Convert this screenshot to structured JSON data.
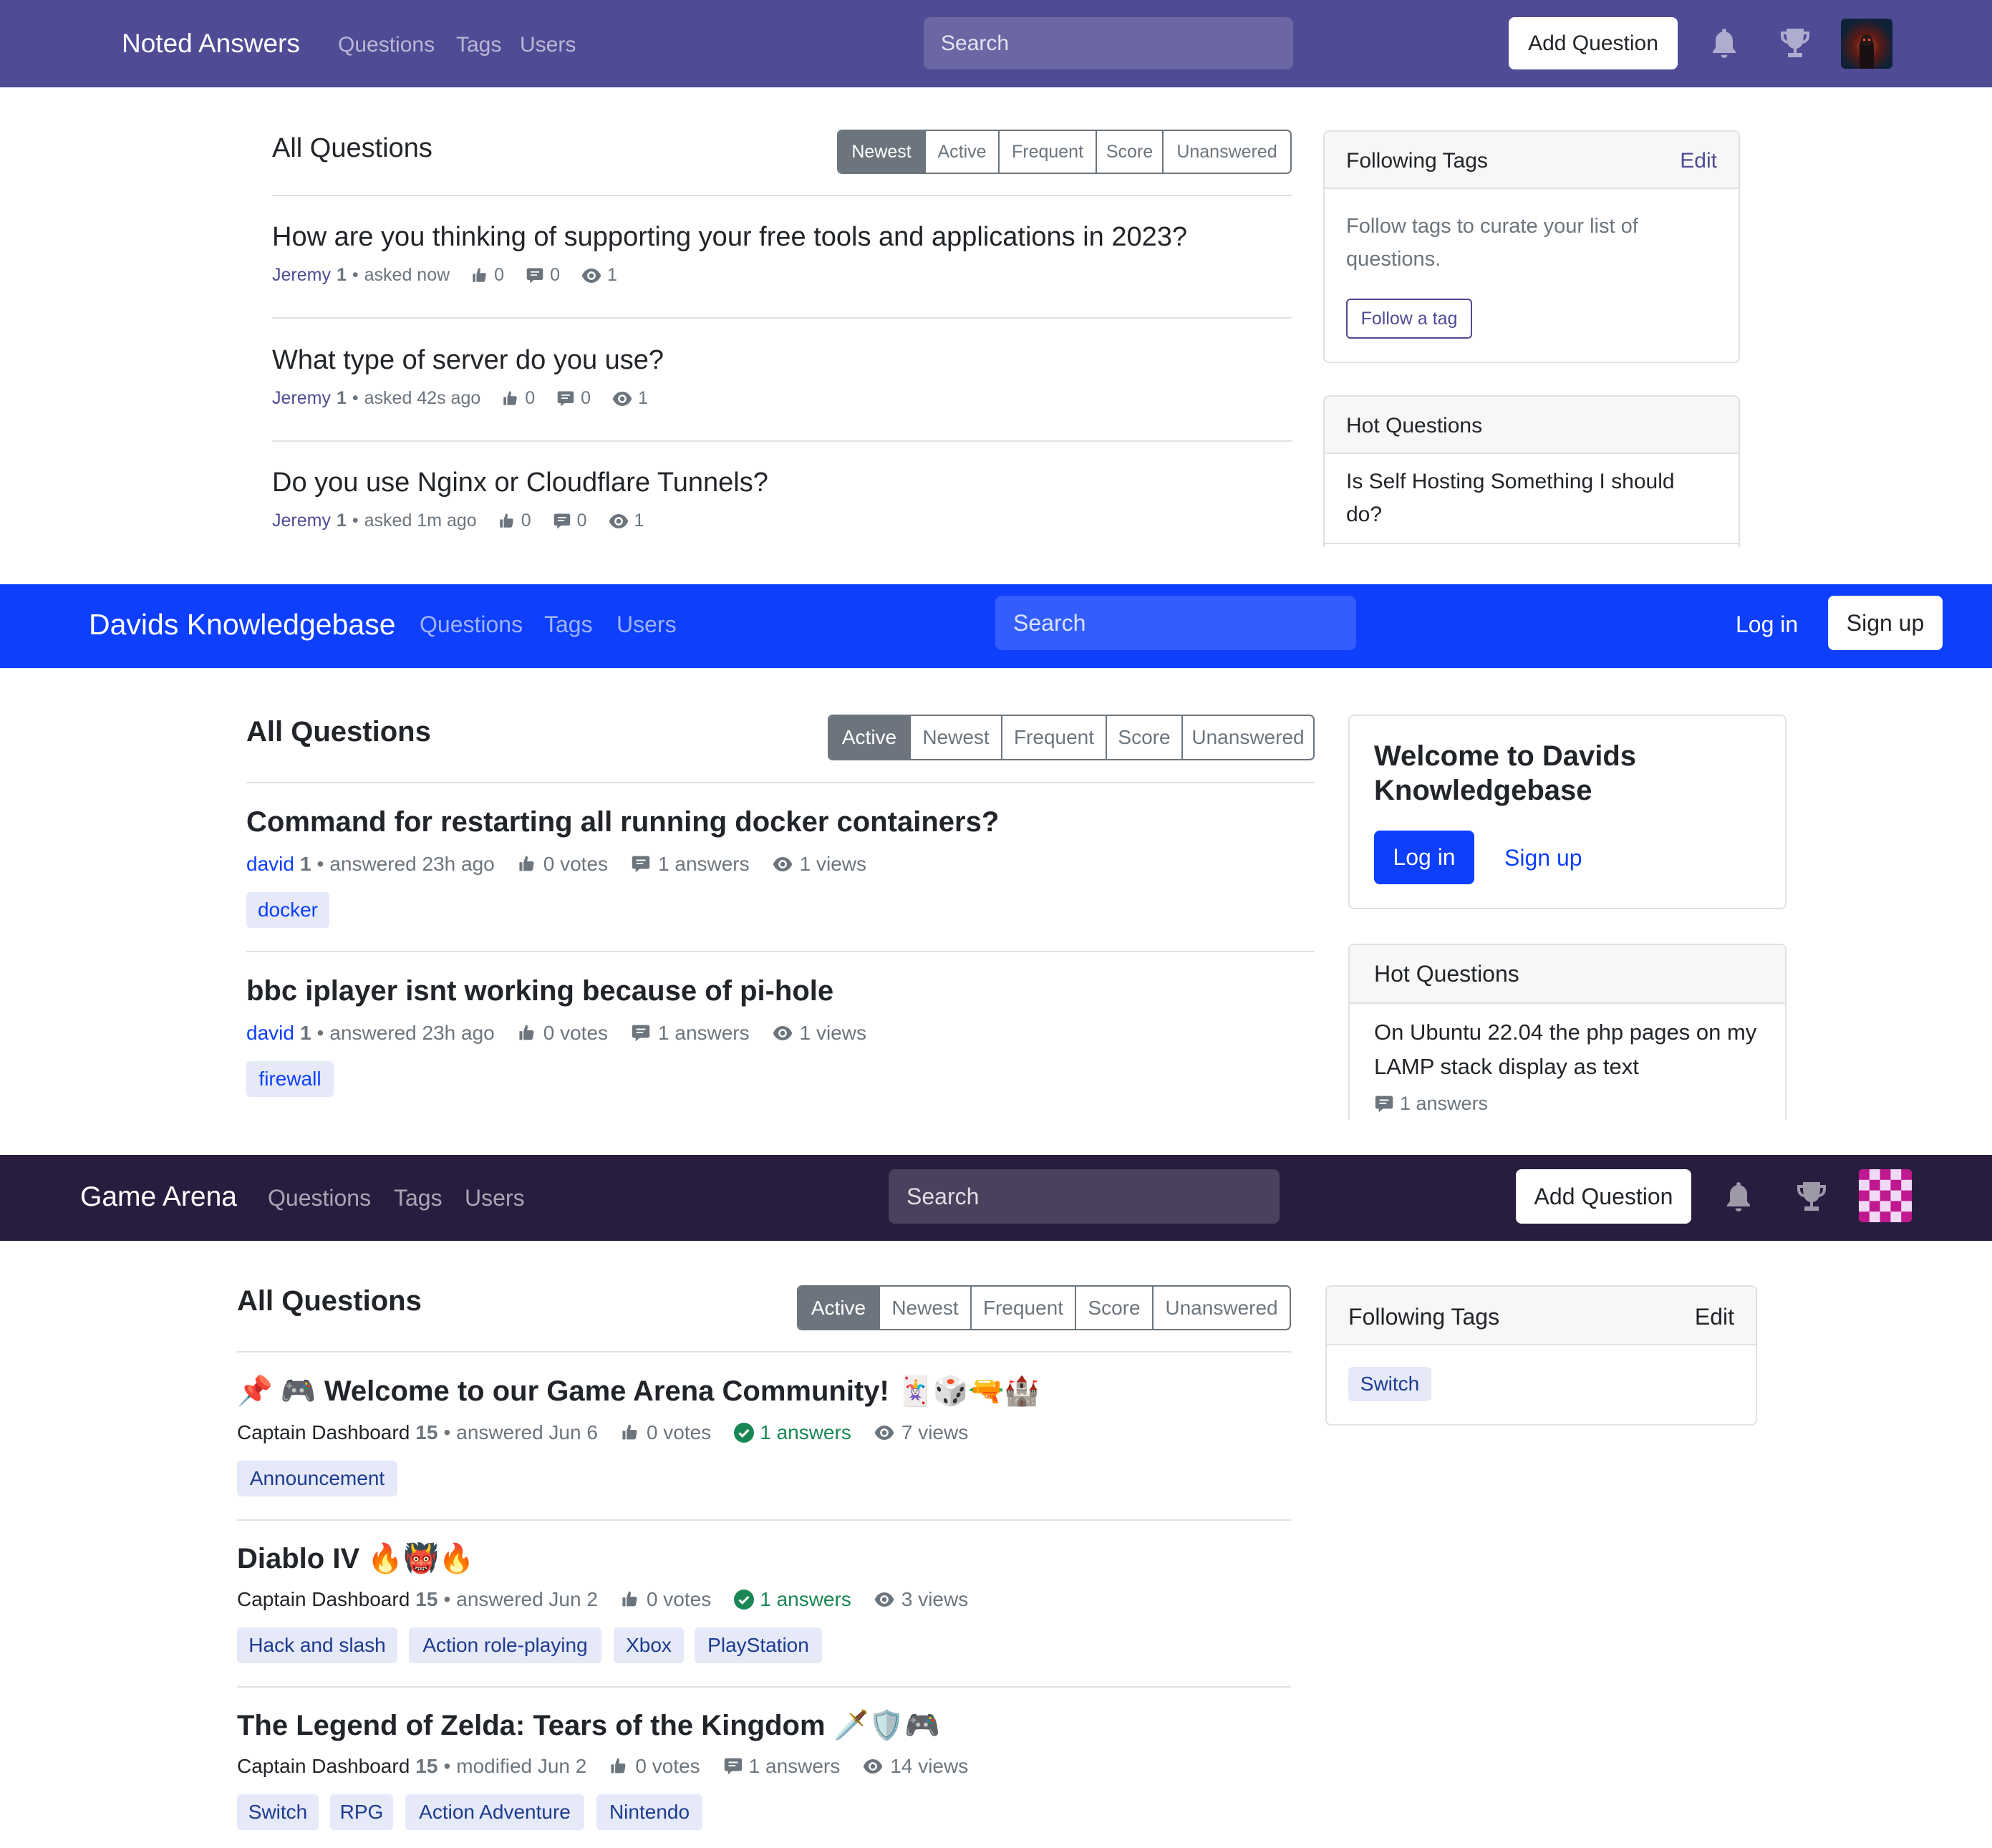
{
  "noted": {
    "brand": "Noted Answers",
    "nav": [
      "Questions",
      "Tags",
      "Users"
    ],
    "search_placeholder": "Search",
    "add_question": "Add Question",
    "page_title": "All Questions",
    "filters": [
      "Newest",
      "Active",
      "Frequent",
      "Score",
      "Unanswered"
    ],
    "active_filter": "Newest",
    "questions": [
      {
        "title": "How are you thinking of supporting your free tools and applications in 2023?",
        "user": "Jeremy",
        "rep": "1",
        "action": "asked now",
        "votes": "0",
        "answers": "0",
        "views": "1"
      },
      {
        "title": "What type of server do you use?",
        "user": "Jeremy",
        "rep": "1",
        "action": "asked 42s ago",
        "votes": "0",
        "answers": "0",
        "views": "1"
      },
      {
        "title": "Do you use Nginx or Cloudflare Tunnels?",
        "user": "Jeremy",
        "rep": "1",
        "action": "asked 1m ago",
        "votes": "0",
        "answers": "0",
        "views": "1"
      }
    ],
    "following": {
      "title": "Following Tags",
      "edit": "Edit",
      "text_line1": "Follow tags to curate your list of",
      "text_line2": "questions.",
      "button": "Follow a tag"
    },
    "hot": {
      "title": "Hot Questions",
      "item_line1": "Is Self Hosting Something I should",
      "item_line2": "do?"
    },
    "colors": {
      "navbar": "#4f4b94",
      "link": "#4f4b94"
    }
  },
  "davids": {
    "brand": "Davids Knowledgebase",
    "nav": [
      "Questions",
      "Tags",
      "Users"
    ],
    "search_placeholder": "Search",
    "login": "Log in",
    "signup": "Sign up",
    "page_title": "All Questions",
    "filters": [
      "Active",
      "Newest",
      "Frequent",
      "Score",
      "Unanswered"
    ],
    "active_filter": "Active",
    "questions": [
      {
        "title": "Command for restarting all running docker containers?",
        "user": "david",
        "rep": "1",
        "action": "answered 23h ago",
        "votes": "0 votes",
        "answers": "1 answers",
        "views": "1 views",
        "tags": [
          "docker"
        ]
      },
      {
        "title": "bbc iplayer isnt working because of pi-hole",
        "user": "david",
        "rep": "1",
        "action": "answered 23h ago",
        "votes": "0 votes",
        "answers": "1 answers",
        "views": "1 views",
        "tags": [
          "firewall"
        ]
      }
    ],
    "welcome": {
      "title_line1": "Welcome to Davids",
      "title_line2": "Knowledgebase",
      "login": "Log in",
      "signup": "Sign up"
    },
    "hot": {
      "title": "Hot Questions",
      "item_line1": "On Ubuntu 22.04 the php pages on my",
      "item_line2": "LAMP stack display as text",
      "item_answers": "1 answers"
    },
    "colors": {
      "navbar": "#0d3ffd",
      "link": "#0d3ffd"
    }
  },
  "arena": {
    "brand": "Game Arena",
    "nav": [
      "Questions",
      "Tags",
      "Users"
    ],
    "search_placeholder": "Search",
    "add_question": "Add Question",
    "page_title": "All Questions",
    "filters": [
      "Active",
      "Newest",
      "Frequent",
      "Score",
      "Unanswered"
    ],
    "active_filter": "Active",
    "questions": [
      {
        "title": "📌 🎮 Welcome to our Game Arena Community! 🃏🎲🔫🏰",
        "user": "Captain Dashboard",
        "rep": "15",
        "action": "answered Jun 6",
        "votes": "0 votes",
        "answers": "1 answers",
        "accepted": true,
        "views": "7 views",
        "tags": [
          "Announcement"
        ]
      },
      {
        "title": "Diablo IV 🔥👹🔥",
        "user": "Captain Dashboard",
        "rep": "15",
        "action": "answered Jun 2",
        "votes": "0 votes",
        "answers": "1 answers",
        "accepted": true,
        "views": "3 views",
        "tags": [
          "Hack and slash",
          "Action role-playing",
          "Xbox",
          "PlayStation"
        ]
      },
      {
        "title": "The Legend of Zelda: Tears of the Kingdom 🗡️🛡️🎮",
        "user": "Captain Dashboard",
        "rep": "15",
        "action": "modified Jun 2",
        "votes": "0 votes",
        "answers": "1 answers",
        "accepted": false,
        "views": "14 views",
        "tags": [
          "Switch",
          "RPG",
          "Action Adventure",
          "Nintendo"
        ]
      }
    ],
    "following": {
      "title": "Following Tags",
      "edit": "Edit",
      "tags": [
        "Switch"
      ]
    },
    "colors": {
      "navbar": "#291d3f",
      "accepted": "#198754",
      "tag_bg": "#e5e9f8",
      "tag_text": "#1d3b8f"
    }
  }
}
